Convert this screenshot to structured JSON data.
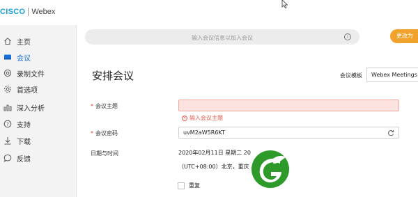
{
  "app": {
    "brand": "CISCO",
    "product": "Webex"
  },
  "sidebar": {
    "items": [
      {
        "label": "主页",
        "icon": "home-icon"
      },
      {
        "label": "会议",
        "icon": "meeting-icon",
        "active": true
      },
      {
        "label": "录制文件",
        "icon": "recording-icon"
      },
      {
        "label": "首选项",
        "icon": "gear-icon"
      },
      {
        "label": "深入分析",
        "icon": "analytics-icon"
      },
      {
        "label": "支持",
        "icon": "help-icon"
      },
      {
        "label": "下载",
        "icon": "download-icon"
      },
      {
        "label": "反馈",
        "icon": "feedback-icon"
      }
    ]
  },
  "header": {
    "search_placeholder": "输入会议信息以加入会议",
    "action_button": "更改为"
  },
  "main": {
    "title": "安排会议",
    "template_label": "会议模板",
    "template_value": "Webex Meetings 默",
    "topic": {
      "label": "会议主题",
      "value": "",
      "error": "输入会议主题"
    },
    "password": {
      "label": "会议密码",
      "value": "uvM2aW5R6KT"
    },
    "datetime": {
      "label": "日期与时间",
      "date": "2020年02月11日 星期二 20",
      "timezone": "（UTC+08:00）北京，重庆"
    },
    "repeat": {
      "label": "重复",
      "checked": false
    }
  },
  "colors": {
    "accent": "#1a6ed8",
    "brand_blue": "#1ba0d7",
    "error": "#e35b4e",
    "orange": "#f0a22c",
    "watermark_green": "#2e9a2a"
  }
}
